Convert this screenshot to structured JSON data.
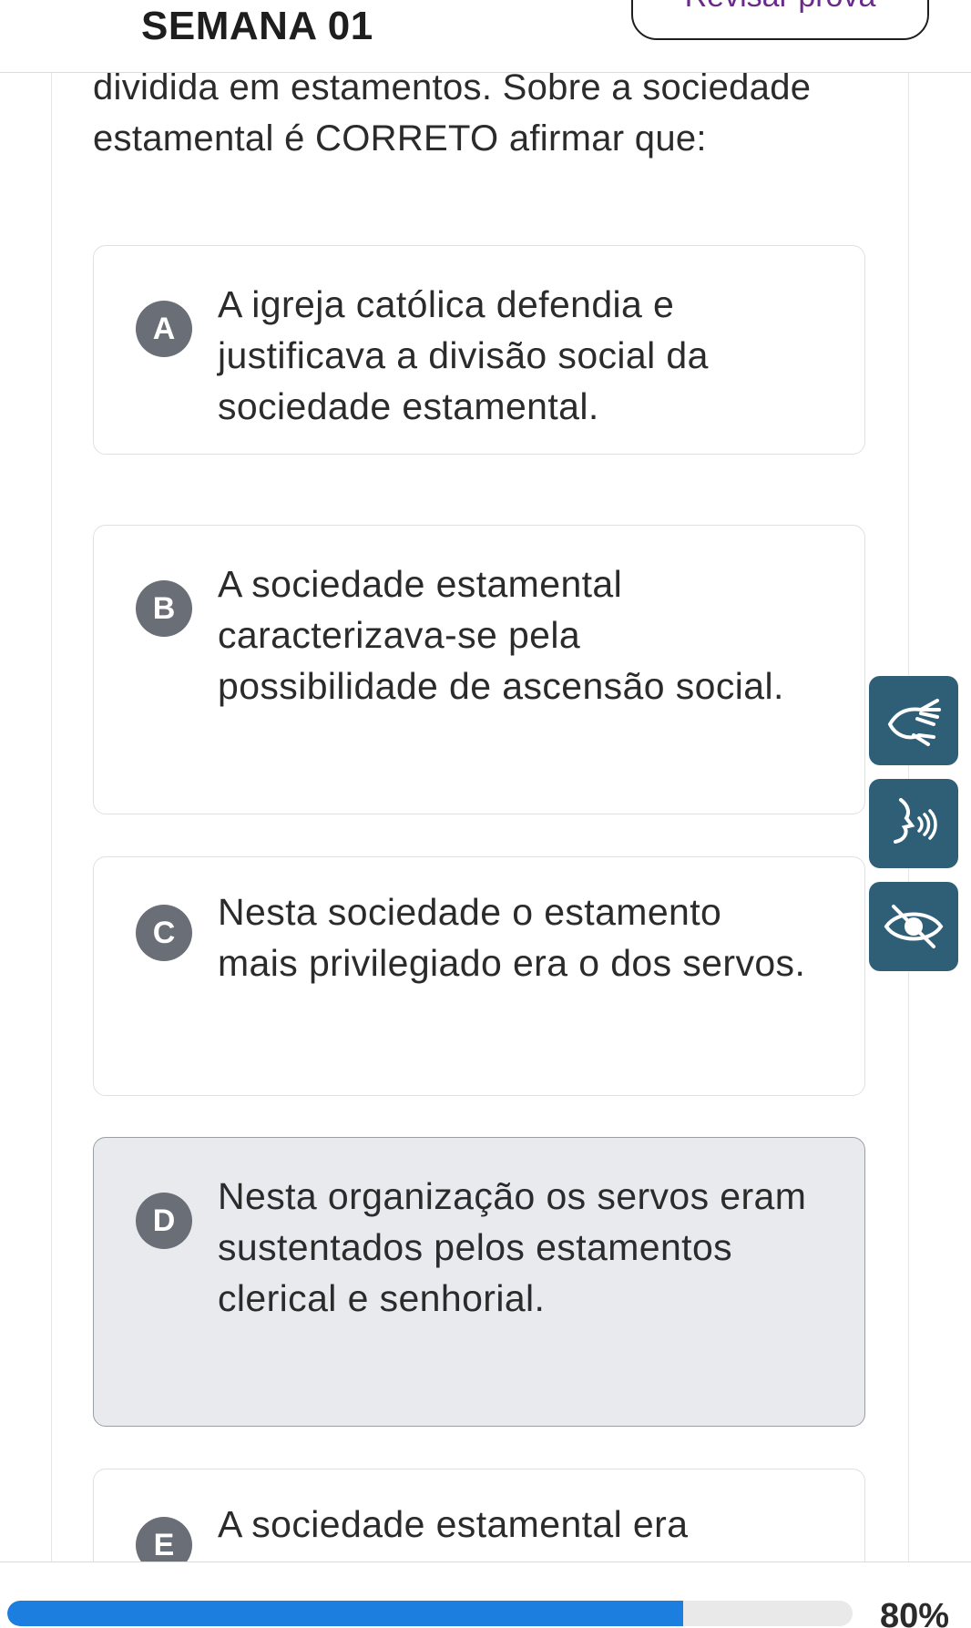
{
  "header": {
    "title": "SEMANA 01",
    "review_button_label": "Revisar prova"
  },
  "question": {
    "text": "dividida em estamentos. Sobre a sociedade estamental é CORRETO afirmar que:"
  },
  "options": [
    {
      "letter": "A",
      "text": "A igreja católica defendia e justificava a divisão social da sociedade estamental.",
      "selected": false
    },
    {
      "letter": "B",
      "text": "A sociedade estamental caracterizava-se pela possibilidade de ascensão social.",
      "selected": false
    },
    {
      "letter": "C",
      "text": "Nesta sociedade o estamento mais privilegiado era o dos servos.",
      "selected": false
    },
    {
      "letter": "D",
      "text": "Nesta organização os servos eram sustentados pelos estamentos clerical e senhorial.",
      "selected": true
    },
    {
      "letter": "E",
      "text": "A sociedade estamental era",
      "selected": false
    }
  ],
  "accessibility": {
    "buttons": [
      "sign-language-icon",
      "text-to-speech-icon",
      "high-contrast-icon"
    ],
    "color": "#2f5f76"
  },
  "progress": {
    "value": 0.8,
    "label": "80%",
    "color": "#1c7fdf"
  }
}
